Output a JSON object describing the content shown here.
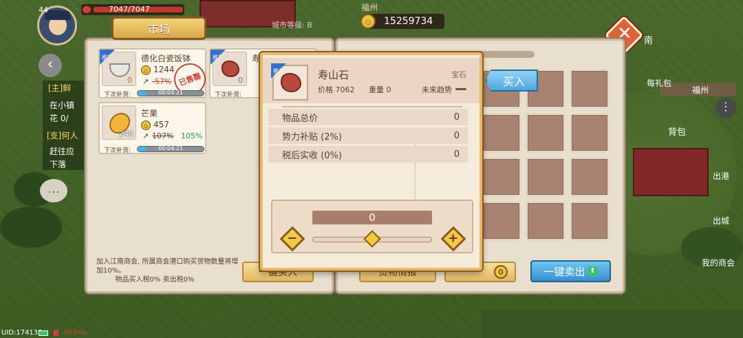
{
  "hud": {
    "level": "44",
    "hp": "7047/7047",
    "city_name": "福州",
    "city_rank_label": "城市等级: B",
    "gold": "15259734",
    "uid": "UID:174135",
    "ping": "403ms"
  },
  "right_menu": {
    "southeast": "南",
    "gift": "每礼包",
    "region": "福州",
    "bag": "背包",
    "port": "出港",
    "city": "出城",
    "my_guild": "我的商会"
  },
  "quest": {
    "tag1": "[主]鲜",
    "text1": "在小镇",
    "text1b": "花  0/",
    "tag2": "[支]何人",
    "text2": "赶往应",
    "text2b": "下落"
  },
  "market": {
    "title": "市场",
    "items": [
      {
        "name": "德化白瓷饭钵",
        "price": "1244",
        "trend": "-57%",
        "qty": "0",
        "restock_label": "下次补货:",
        "restock_time": "00:04:21",
        "sold_out": "已售罄",
        "badge": "推荐"
      },
      {
        "name": "芒果",
        "price": "457",
        "trend_old": "107%",
        "trend_new": "105%",
        "qty": "245",
        "restock_label": "下次补货:",
        "restock_time": "00:04:21"
      },
      {
        "name": "寿",
        "qty": "0",
        "restock_label": "下次补货:",
        "badge": "推荐"
      }
    ],
    "guild_note": "加入江南商会, 所属商会港口购买货物数量将增加10%。",
    "tax_note": "物品买入税0% 卖出税0%",
    "buy_button": "一键买入"
  },
  "cargo": {
    "info_button": "货物情报",
    "count": "0",
    "sell_all": "一键卖出"
  },
  "dialog": {
    "item_name": "寿山石",
    "badge": "推荐",
    "category": "宝石",
    "price_label": "价格 7062",
    "weight_label": "重量 0",
    "trend_label": "未来趋势",
    "rows": [
      {
        "label": "物品总价",
        "value": "0"
      },
      {
        "label": "势力补贴 (2%)",
        "value": "0"
      },
      {
        "label": "税后实收 (0%)",
        "value": "0"
      }
    ],
    "quantity": "0",
    "minus": "−",
    "plus": "+",
    "action": "买入"
  }
}
